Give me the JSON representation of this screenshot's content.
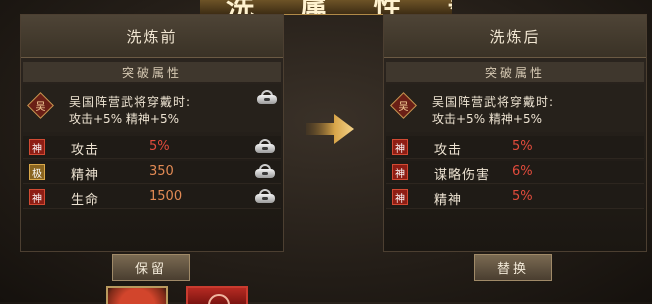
{
  "banner": {
    "glyphs": "洗 属 性 录"
  },
  "before": {
    "title": "洗炼前",
    "subtitle": "突破属性",
    "bonus": {
      "badge": "吴",
      "line1": "吴国阵营武将穿戴时:",
      "line2": "攻击+5%  精神+5%"
    },
    "rows": [
      {
        "badge": "神",
        "badge_color": "red",
        "name": "攻击",
        "value": "5%",
        "value_color": "red"
      },
      {
        "badge": "极",
        "badge_color": "gold",
        "name": "精神",
        "value": "350",
        "value_color": "orange"
      },
      {
        "badge": "神",
        "badge_color": "red",
        "name": "生命",
        "value": "1500",
        "value_color": "orange"
      }
    ]
  },
  "after": {
    "title": "洗炼后",
    "subtitle": "突破属性",
    "bonus": {
      "badge": "吴",
      "line1": "吴国阵营武将穿戴时:",
      "line2": "攻击+5%  精神+5%"
    },
    "rows": [
      {
        "badge": "神",
        "badge_color": "red",
        "name": "攻击",
        "value": "5%",
        "value_color": "red"
      },
      {
        "badge": "神",
        "badge_color": "red",
        "name": "谋略伤害",
        "value": "6%",
        "value_color": "red"
      },
      {
        "badge": "神",
        "badge_color": "red",
        "name": "精神",
        "value": "5%",
        "value_color": "red"
      }
    ]
  },
  "buttons": {
    "keep": "保留",
    "replace": "替换"
  },
  "colors": {
    "value_red": "#e24b3c",
    "value_orange": "#e28a54",
    "badge_red": "#8e1d14",
    "badge_gold": "#8a6520"
  }
}
